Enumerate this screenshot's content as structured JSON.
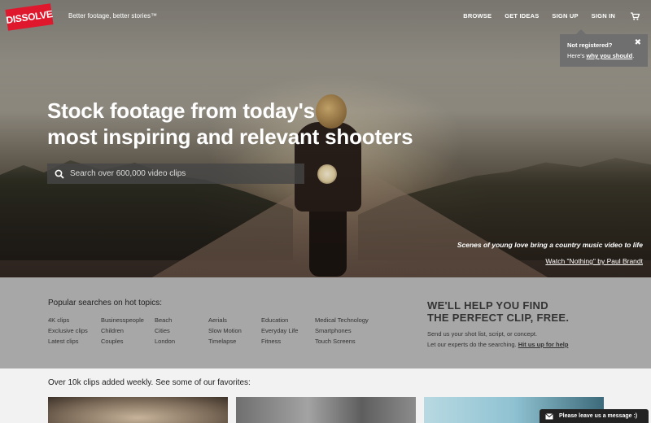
{
  "header": {
    "logo": "DISSOLVE",
    "tagline": "Better footage, better stories™",
    "nav": [
      "BROWSE",
      "GET IDEAS",
      "SIGN UP",
      "SIGN IN"
    ]
  },
  "tooltip": {
    "title": "Not registered?",
    "text_prefix": "Here's ",
    "link": "why you should",
    "text_suffix": ".",
    "close": "✖"
  },
  "hero": {
    "headline_line1": "Stock footage from today's",
    "headline_line2": "most inspiring and relevant shooters",
    "search_placeholder": "Search over 600,000 video clips",
    "caption": "Scenes of young love bring a country music video to life",
    "caption_link": "Watch \"Nothing\" by Paul Brandt"
  },
  "popular": {
    "title": "Popular searches on hot topics:",
    "columns": [
      [
        "4K clips",
        "Exclusive clips",
        "Latest clips"
      ],
      [
        "Businesspeople",
        "Children",
        "Couples"
      ],
      [
        "Beach",
        "Cities",
        "London"
      ],
      [
        "Aerials",
        "Slow Motion",
        "Timelapse"
      ],
      [
        "Education",
        "Everyday Life",
        "Fitness"
      ],
      [
        "Medical Technology",
        "Smartphones",
        "Touch Screens"
      ]
    ]
  },
  "help": {
    "heading_line1": "WE'LL HELP YOU FIND",
    "heading_line2": "THE PERFECT CLIP, FREE.",
    "line1": "Send us your shot list, script, or concept.",
    "line2_prefix": "Let our experts do the searching. ",
    "line2_link": "Hit us up for help"
  },
  "clips": {
    "title": "Over 10k clips added weekly. See some of our favorites:"
  },
  "chat": {
    "label": "Please leave us a message :)"
  },
  "colors": {
    "brand_red": "#e0182d",
    "popular_bg": "#a7a7a7",
    "chat_bg": "#222222"
  }
}
